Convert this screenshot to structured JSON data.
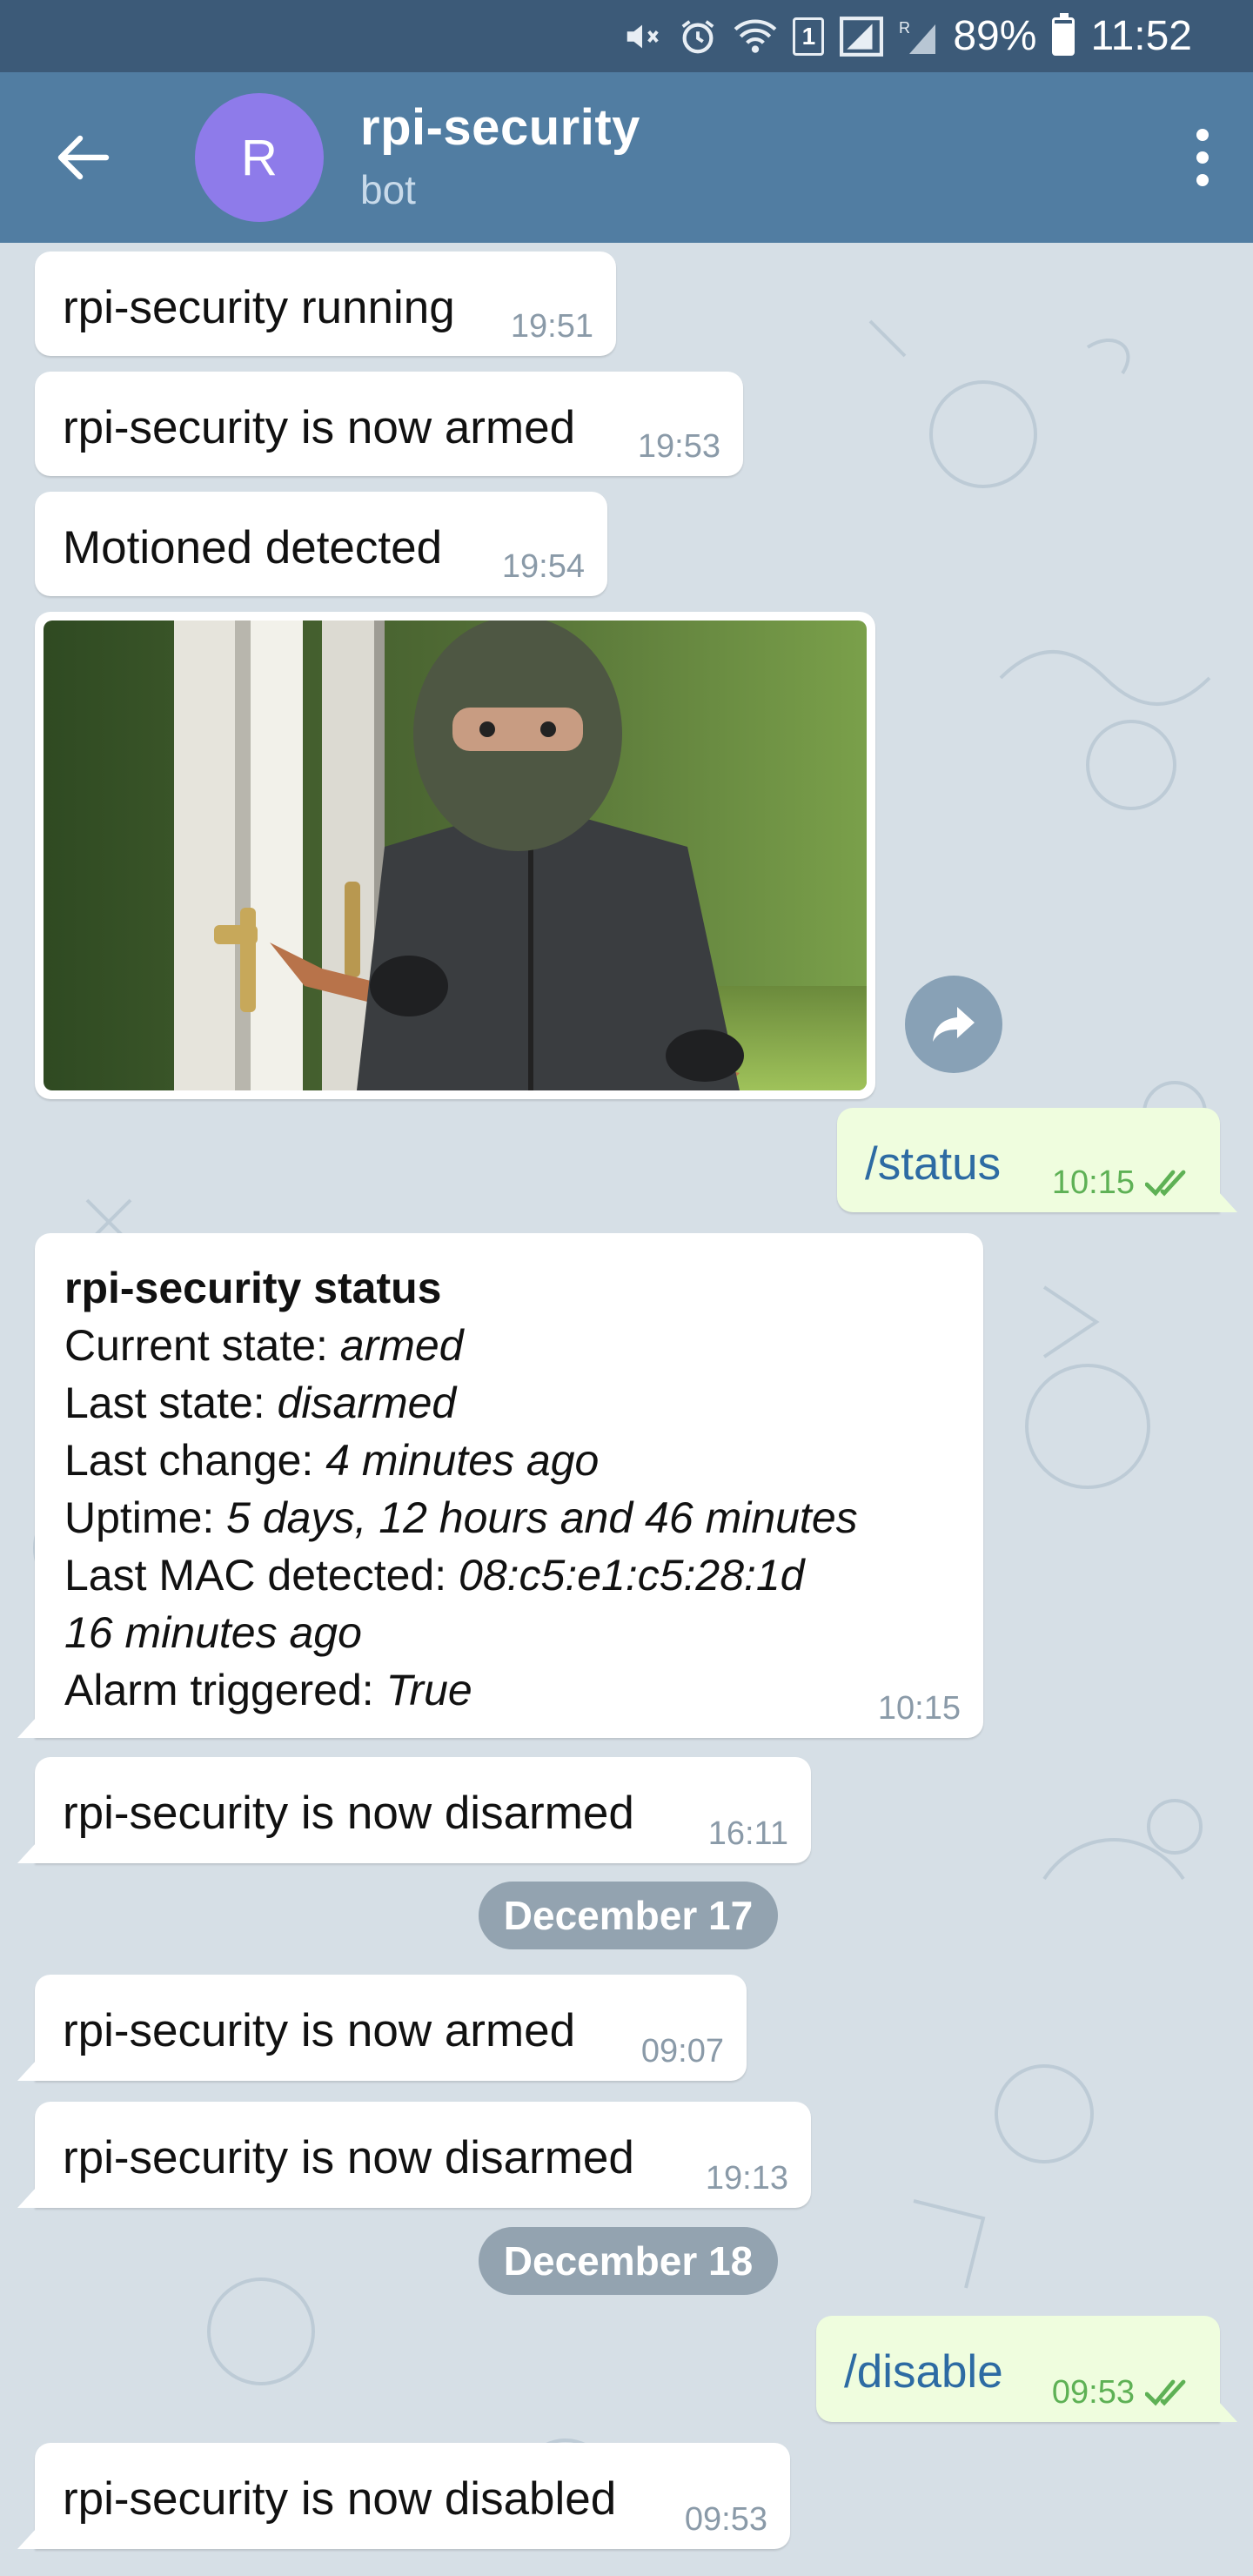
{
  "status_bar": {
    "sim_badge": "1",
    "battery": "89%",
    "time": "11:52",
    "icons": [
      "mute-icon",
      "alarm-icon",
      "wifi-icon",
      "sim-icon",
      "signal-icon",
      "signal-roaming-icon",
      "battery-icon"
    ]
  },
  "header": {
    "avatar_letter": "R",
    "title": "rpi-security",
    "subtitle": "bot",
    "avatar_color": "#8e7bea",
    "bar_color": "#517da2"
  },
  "messages": [
    {
      "text": "rpi-security running",
      "time": "19:51"
    },
    {
      "text": "rpi-security is now armed",
      "time": "19:53"
    },
    {
      "text": "Motioned detected",
      "time": "19:54"
    },
    {
      "text": "/status",
      "time": "10:15"
    },
    {
      "text": "rpi-security is now disarmed",
      "time": "16:11"
    },
    {
      "text": "rpi-security is now armed",
      "time": "09:07"
    },
    {
      "text": "rpi-security is now disarmed",
      "time": "19:13"
    },
    {
      "text": "/disable",
      "time": "09:53"
    },
    {
      "text": "rpi-security is now disabled",
      "time": "09:53"
    }
  ],
  "status_report": {
    "title": "rpi-security status",
    "current_state_label": "Current state: ",
    "current_state_value": "armed",
    "last_state_label": "Last state: ",
    "last_state_value": "disarmed",
    "last_change_label": "Last change: ",
    "last_change_value": "4 minutes ago",
    "uptime_label": "Uptime: ",
    "uptime_value": "5 days, 12 hours and 46 minutes",
    "mac_label": "Last MAC detected: ",
    "mac_value": "08:c5:e1:c5:28:1d",
    "mac_ago": "16 minutes ago",
    "alarm_label": "Alarm triggered: ",
    "alarm_value": "True",
    "time": "10:15"
  },
  "dates": [
    "December 17",
    "December 18"
  ],
  "colors": {
    "outgoing_bubble": "#effdde",
    "outgoing_text": "#2d6ba3",
    "read_checks": "#5eb155",
    "chat_background": "#d6dfe6"
  }
}
